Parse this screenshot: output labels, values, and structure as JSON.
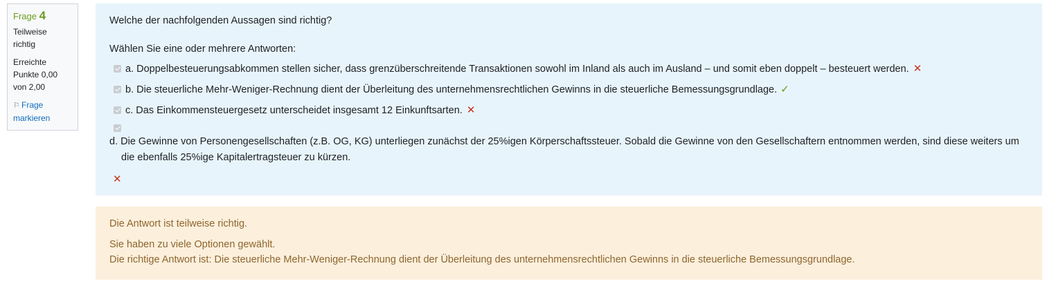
{
  "info": {
    "label": "Frage",
    "number": "4",
    "state_line1": "Teilweise",
    "state_line2": "richtig",
    "grade_line1": "Erreichte",
    "grade_line2": "Punkte 0,00",
    "grade_line3": "von 2,00",
    "flag_line1": "Frage",
    "flag_line2": "markieren"
  },
  "question": {
    "text": "Welche der nachfolgenden Aussagen sind richtig?",
    "prompt": "Wählen Sie eine oder mehrere Antworten:",
    "answers": [
      {
        "text": "a. Doppelbesteuerungsabkommen stellen sicher, dass grenzüberschreitende Transaktionen sowohl im Inland als auch im Ausland – und somit eben doppelt – besteuert werden.",
        "checked": true,
        "mark": "✕"
      },
      {
        "text": "b. Die steuerliche Mehr-Weniger-Rechnung dient der Überleitung des unternehmensrechtlichen Gewinns in die steuerliche Bemessungsgrundlage.",
        "checked": true,
        "mark": "✓"
      },
      {
        "text": "c. Das Einkommensteuergesetz unterscheidet insgesamt 12 Einkunftsarten.",
        "checked": true,
        "mark": "✕"
      },
      {
        "text": "d. Die Gewinne von Personengesellschaften (z.B. OG, KG) unterliegen zunächst der 25%igen Körperschaftssteuer. Sobald die Gewinne von den Gesellschaftern entnommen werden, sind diese weiters um die ebenfalls 25%ige Kapitalertragsteuer zu kürzen.",
        "checked": true,
        "mark": "✕"
      }
    ]
  },
  "feedback": {
    "state": "Die Antwort ist teilweise richtig.",
    "detail": "Sie haben zu viele Optionen gewählt.",
    "right_answer": "Die richtige Antwort ist: Die steuerliche Mehr-Weniger-Rechnung dient der Überleitung des unternehmensrechtlichen Gewinns in die steuerliche Bemessungsgrundlage."
  },
  "colors": {
    "question_bg": "#e8f4fb",
    "feedback_bg": "#fcefdc",
    "feedback_text": "#8e662e",
    "incorrect": "#ca3120",
    "correct": "#5e9b21",
    "number_green": "#6a9c1f",
    "link": "#0f6cbf"
  }
}
